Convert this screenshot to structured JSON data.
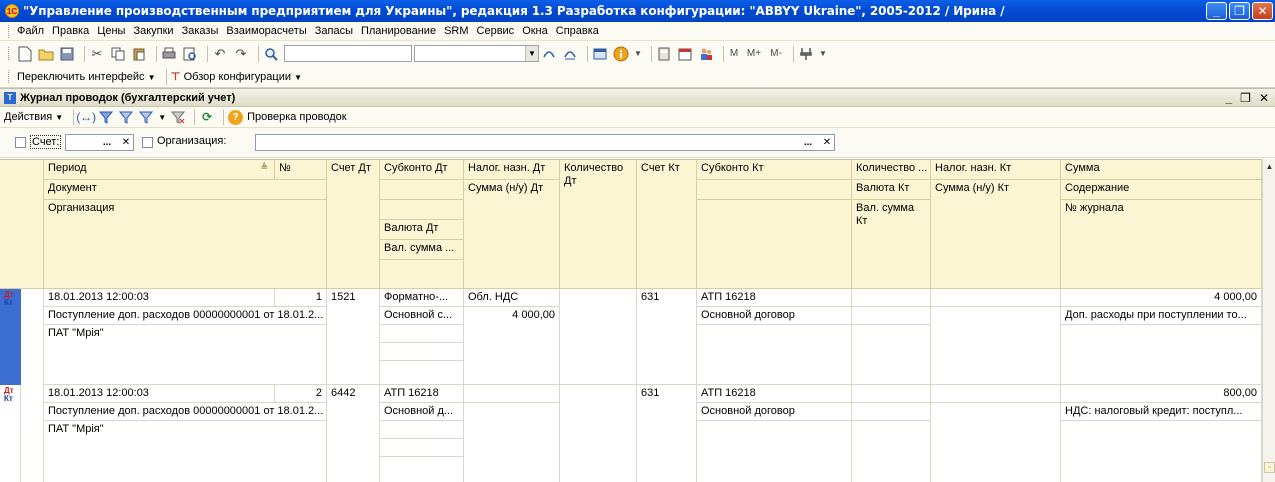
{
  "window": {
    "title": "\"Управление производственным предприятием для Украины\", редакция 1.3 Разработка конфигурации: \"ABBYY Ukraine\", 2005-2012 / Ирина /",
    "app_icon_text": "1С",
    "minimize": "_",
    "maximize": "❐",
    "close": "✕"
  },
  "menu": {
    "items": [
      "Файл",
      "Правка",
      "Цены",
      "Закупки",
      "Заказы",
      "Взаиморасчеты",
      "Запасы",
      "Планирование",
      "SRM",
      "Сервис",
      "Окна",
      "Справка"
    ]
  },
  "toolbar": {
    "icons": [
      "new-document-icon",
      "open-folder-icon",
      "save-icon",
      "cut-icon",
      "copy-icon",
      "paste-icon",
      "print-icon",
      "print-preview-icon",
      "undo-icon",
      "redo-icon",
      "search-icon"
    ],
    "search_value": "",
    "memory": [
      "M",
      "M+",
      "M-"
    ]
  },
  "interface_bar": {
    "switch_label": "Переключить интерфейс",
    "overview_label": "Обзор конфигурации"
  },
  "journal": {
    "title": "Журнал проводок (бухгалтерский учет)",
    "ctrl_min": "_",
    "ctrl_restore": "❐",
    "ctrl_close": "✕",
    "actions_label": "Действия",
    "check_label": "Проверка проводок",
    "filter": {
      "account_label": "Счет:",
      "account_value": "",
      "org_label": "Организация:",
      "org_value": "",
      "dots": "...",
      "clear": "✕"
    },
    "headers": {
      "period": "Период",
      "number": "№",
      "document": "Документ",
      "organization": "Организация",
      "account_dt": "Счет Дт",
      "subkonto_dt": "Субконто Дт",
      "currency_dt": "Валюта Дт",
      "val_sum_dt": "Вал. сумма ...",
      "tax_dt": "Налог. назн. Дт",
      "sum_nu_dt": "Сумма (н/у) Дт",
      "qty_dt": "Количество Дт",
      "account_kt": "Счет Кт",
      "subkonto_kt": "Субконто Кт",
      "qty_kt": "Количество ...",
      "currency_kt": "Валюта Кт",
      "val_sum_kt": "Вал. сумма Кт",
      "tax_kt": "Налог. назн. Кт",
      "sum_nu_kt": "Сумма (н/у) Кт",
      "sum": "Сумма",
      "content": "Содержание",
      "journal_no": "№ журнала"
    },
    "rows": [
      {
        "period": "18.01.2013 12:00:03",
        "number": "1",
        "document": "Поступление доп. расходов 00000000001 от 18.01.2...",
        "organization": "ПАТ \"Мрія\"",
        "account_dt": "1521",
        "subkonto_dt_1": "Форматно-...",
        "subkonto_dt_2": "Основной с...",
        "tax_dt": "Обл. НДС",
        "sum_nu_dt": "4 000,00",
        "account_kt": "631",
        "subkonto_kt_1": "АТП 16218",
        "subkonto_kt_2": "Основной договор",
        "sum": "4 000,00",
        "content": "Доп. расходы при поступлении то..."
      },
      {
        "period": "18.01.2013 12:00:03",
        "number": "2",
        "document": "Поступление доп. расходов 00000000001 от 18.01.2...",
        "organization": "ПАТ \"Мрія\"",
        "account_dt": "6442",
        "subkonto_dt_1": "АТП 16218",
        "subkonto_dt_2": "Основной д...",
        "tax_dt": "",
        "sum_nu_dt": "",
        "account_kt": "631",
        "subkonto_kt_1": "АТП 16218",
        "subkonto_kt_2": "Основной договор",
        "sum": "800,00",
        "content": "НДС: налоговый кредит: поступл..."
      }
    ],
    "dt_mark": "Дт",
    "kt_mark": "Кт"
  }
}
